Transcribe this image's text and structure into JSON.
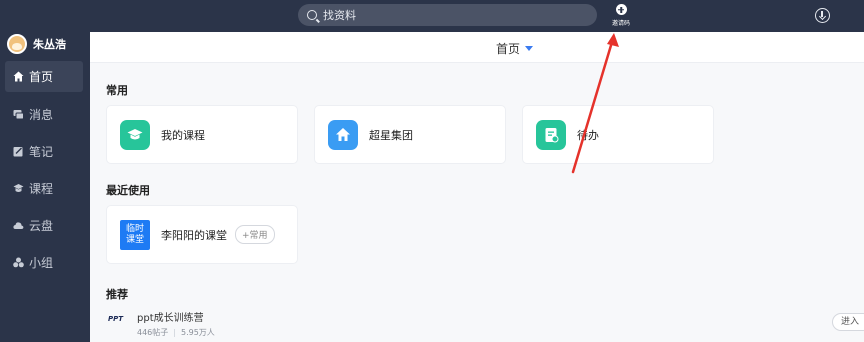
{
  "topbar": {
    "search_label": "找资料",
    "invite_label": "邀请码"
  },
  "sidebar": {
    "username": "朱丛浩",
    "items": [
      {
        "label": "首页",
        "icon": "home-icon",
        "active": true
      },
      {
        "label": "消息",
        "icon": "message-icon",
        "active": false
      },
      {
        "label": "笔记",
        "icon": "note-icon",
        "active": false
      },
      {
        "label": "课程",
        "icon": "course-icon",
        "active": false
      },
      {
        "label": "云盘",
        "icon": "cloud-icon",
        "active": false
      },
      {
        "label": "小组",
        "icon": "group-icon",
        "active": false
      }
    ]
  },
  "main": {
    "header_title": "首页",
    "common": {
      "title": "常用",
      "cards": [
        {
          "label": "我的课程",
          "icon": "graduation-cap-icon",
          "color": "#27c59a"
        },
        {
          "label": "超星集团",
          "icon": "house-icon",
          "color": "#3a9cf3"
        },
        {
          "label": "待办",
          "icon": "todo-icon",
          "color": "#27c59a"
        }
      ]
    },
    "recent": {
      "title": "最近使用",
      "item": {
        "badge_line1": "临时",
        "badge_line2": "课堂",
        "label": "李阳阳的课堂",
        "pill": "+常用"
      }
    },
    "recommend": {
      "title": "推荐",
      "item": {
        "logo_text": "PPT",
        "name": "ppt成长训练营",
        "posts": "446帖子",
        "members": "5.95万人",
        "action": "进入"
      }
    }
  },
  "colors": {
    "sidebar_bg": "#2b3449",
    "accent": "#3a7bf0",
    "annotation_arrow": "#e5322b"
  }
}
